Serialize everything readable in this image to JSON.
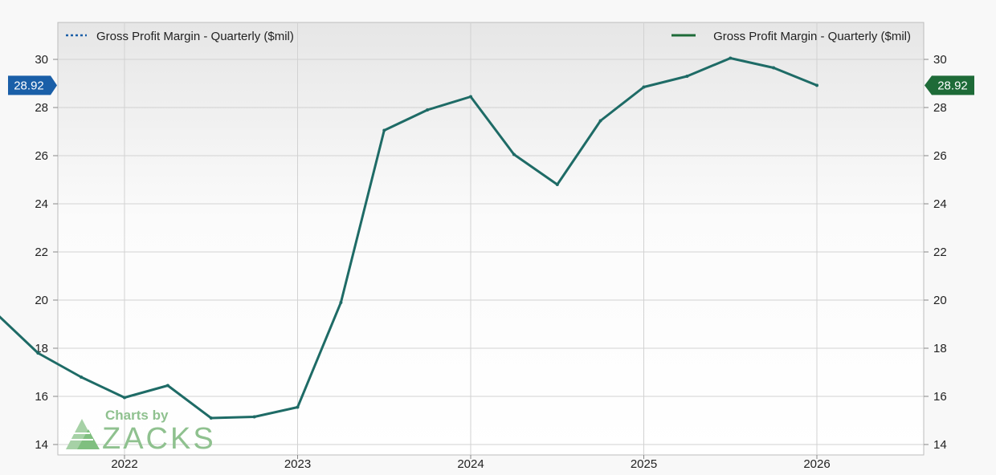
{
  "chart_data": {
    "type": "line",
    "x_ticks": [
      "2022",
      "2023",
      "2024",
      "2025",
      "2026"
    ],
    "ylim": [
      13.5,
      31.5
    ],
    "y_ticks": [
      14,
      16,
      18,
      20,
      22,
      24,
      26,
      28,
      30
    ],
    "grid": true,
    "legend": [
      {
        "label": "Gross Profit Margin - Quarterly ($mil)",
        "style": "dotted",
        "color": "#1a5fa8",
        "placement": "top-left"
      },
      {
        "label": "Gross Profit Margin - Quarterly ($mil)",
        "style": "solid",
        "color": "#1e6b38",
        "placement": "top-right"
      }
    ],
    "series": [
      {
        "color": "#1e6b66",
        "x": [
          "2021-Q3",
          "2021-Q4",
          "2022-Q1",
          "2022-Q2",
          "2022-Q3",
          "2022-Q4",
          "2023-Q1",
          "2023-Q2",
          "2023-Q3",
          "2023-Q4",
          "2024-Q1",
          "2024-Q2",
          "2024-Q3",
          "2024-Q4",
          "2025-Q1",
          "2025-Q2",
          "2025-Q3",
          "2025-Q4",
          "2026-Q1",
          "2026-Q2"
        ],
        "values": [
          19.5,
          17.8,
          16.8,
          15.95,
          16.45,
          15.1,
          15.15,
          15.55,
          19.9,
          27.05,
          27.9,
          28.45,
          26.05,
          24.8,
          27.45,
          28.85,
          29.3,
          30.05,
          29.65,
          28.92
        ]
      }
    ],
    "last_value_left": {
      "label": "28.92",
      "color": "#1a5fa8"
    },
    "last_value_right": {
      "label": "28.92",
      "color": "#1e6b38"
    }
  },
  "watermark": {
    "line1": "Charts by",
    "line2": "ZACKS"
  }
}
